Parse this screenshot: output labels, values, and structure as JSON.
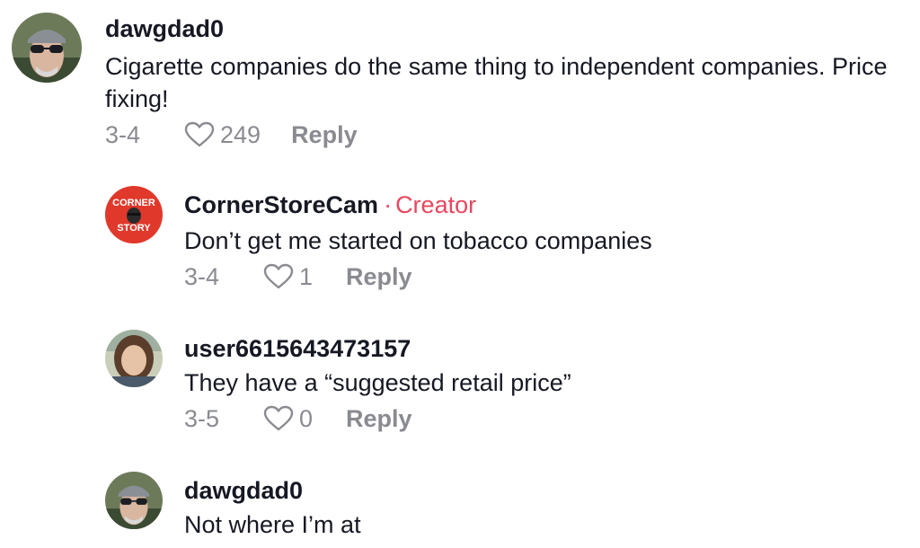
{
  "comments": [
    {
      "username": "dawgdad0",
      "text": "Cigarette companies do the same thing to independent companies. Price fixing!",
      "date": "3-4",
      "likes": "249",
      "reply_label": "Reply"
    },
    {
      "username": "CornerStoreCam",
      "creator_label": "Creator",
      "creator_sep": "·",
      "avatar_text_top": "CORNER",
      "avatar_text_bottom": "STORY",
      "text": "Don’t get me started on tobacco companies",
      "date": "3-4",
      "likes": "1",
      "reply_label": "Reply"
    },
    {
      "username": "user6615643473157",
      "text": "They have a “suggested retail price”",
      "date": "3-5",
      "likes": "0",
      "reply_label": "Reply"
    },
    {
      "username": "dawgdad0",
      "text": "Not where I’m at"
    }
  ],
  "colors": {
    "creator": "#e8475f",
    "meta": "#8a8b91",
    "text": "#161823"
  },
  "icons": {
    "like": "heart-outline-icon"
  }
}
